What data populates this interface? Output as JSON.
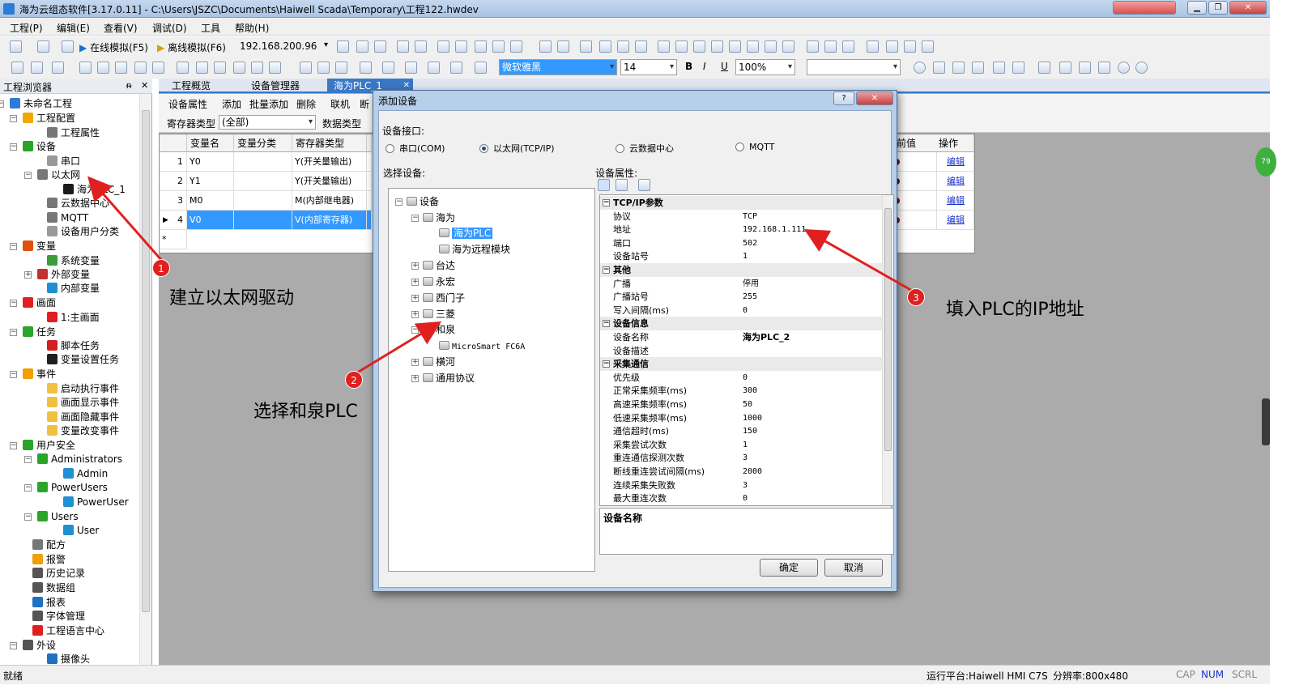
{
  "window": {
    "title": "海为云组态软件[3.17.0.11] - C:\\Users\\JSZC\\Documents\\Haiwell Scada\\Temporary\\工程122.hwdev"
  },
  "menu": [
    "工程(P)",
    "编辑(E)",
    "查看(V)",
    "调试(D)",
    "工具",
    "帮助(H)"
  ],
  "toolbar1": {
    "online_sim": "在线模拟(F5)",
    "offline_sim": "离线模拟(F6)",
    "ip": "192.168.200.96"
  },
  "toolbar2": {
    "font_name": "微软雅黑",
    "font_size": "14",
    "zoom": "100%",
    "bold": "B",
    "italic": "I",
    "underline": "U"
  },
  "explorer": {
    "title": "工程浏览器",
    "pin": "ᵰ",
    "close": "✕"
  },
  "tree": [
    {
      "label": "未命名工程",
      "icon": "project-icon",
      "color": "#2c7bd4"
    },
    {
      "label": "工程配置",
      "icon": "gear-icon",
      "color": "#f0a800"
    },
    {
      "label": "工程属性",
      "icon": "properties-icon",
      "color": "#777777"
    },
    {
      "label": "设备",
      "icon": "device-icon",
      "color": "#2aa52a"
    },
    {
      "label": "串口",
      "icon": "serial-port-icon",
      "color": "#999999"
    },
    {
      "label": "以太网",
      "icon": "ethernet-icon",
      "color": "#777777"
    },
    {
      "label": "海为PLC_1",
      "icon": "plc-icon",
      "color": "#1a1a1a"
    },
    {
      "label": "云数据中心",
      "icon": "cloud-icon",
      "color": "#777777"
    },
    {
      "label": "MQTT",
      "icon": "mqtt-icon",
      "color": "#777777"
    },
    {
      "label": "设备用户分类",
      "icon": "user-class-icon",
      "color": "#999999"
    },
    {
      "label": "变量",
      "icon": "variable-icon",
      "color": "#e05010"
    },
    {
      "label": "系统变量",
      "icon": "system-variable-icon",
      "color": "#3c9c3c"
    },
    {
      "label": "外部变量",
      "icon": "external-variable-icon",
      "color": "#c03030"
    },
    {
      "label": "内部变量",
      "icon": "internal-variable-icon",
      "color": "#1f8fd0"
    },
    {
      "label": "画面",
      "icon": "screen-icon",
      "color": "#e02020"
    },
    {
      "label": "1:主画面",
      "icon": "main-screen-icon",
      "color": "#e02020"
    },
    {
      "label": "任务",
      "icon": "task-icon",
      "color": "#2aa52a"
    },
    {
      "label": "脚本任务",
      "icon": "script-task-icon",
      "color": "#d02020"
    },
    {
      "label": "变量设置任务",
      "icon": "variable-task-icon",
      "color": "#202020"
    },
    {
      "label": "事件",
      "icon": "event-icon",
      "color": "#f0a000"
    },
    {
      "label": "启动执行事件",
      "icon": "event-start-icon",
      "color": "#f0c040"
    },
    {
      "label": "画面显示事件",
      "icon": "event-show-icon",
      "color": "#f0c040"
    },
    {
      "label": "画面隐藏事件",
      "icon": "event-hide-icon",
      "color": "#f0c040"
    },
    {
      "label": "变量改变事件",
      "icon": "event-change-icon",
      "color": "#f0c040"
    },
    {
      "label": "用户安全",
      "icon": "user-security-icon",
      "color": "#2aa52a"
    },
    {
      "label": "Administrators",
      "icon": "group-icon",
      "color": "#2aa52a"
    },
    {
      "label": "Admin",
      "icon": "user-icon",
      "color": "#2090d0"
    },
    {
      "label": "PowerUsers",
      "icon": "group-icon",
      "color": "#2aa52a"
    },
    {
      "label": "PowerUser",
      "icon": "user-icon",
      "color": "#2090d0"
    },
    {
      "label": "Users",
      "icon": "group-icon",
      "color": "#2aa52a"
    },
    {
      "label": "User",
      "icon": "user-icon",
      "color": "#2090d0"
    },
    {
      "label": "配方",
      "icon": "recipe-icon",
      "color": "#777777"
    },
    {
      "label": "报警",
      "icon": "alarm-icon",
      "color": "#f0a000"
    },
    {
      "label": "历史记录",
      "icon": "history-icon",
      "color": "#555555"
    },
    {
      "label": "数据组",
      "icon": "datagroup-icon",
      "color": "#555555"
    },
    {
      "label": "报表",
      "icon": "report-icon",
      "color": "#2070c0"
    },
    {
      "label": "字体管理",
      "icon": "font-icon",
      "color": "#555555"
    },
    {
      "label": "工程语言中心",
      "icon": "language-icon",
      "color": "#e02020"
    },
    {
      "label": "外设",
      "icon": "peripheral-icon",
      "color": "#555555"
    },
    {
      "label": "摄像头",
      "icon": "camera-icon",
      "color": "#2070c0"
    }
  ],
  "tabs": [
    "工程概览",
    "设备管理器",
    "海为PLC_1"
  ],
  "grid_toolbar": {
    "row1": [
      "设备属性",
      "添加",
      "批量添加",
      "删除",
      "联机",
      "断"
    ],
    "reg_type_label": "寄存器类型",
    "reg_type_value": "(全部)",
    "data_type_label": "数据类型"
  },
  "grid": {
    "headers": [
      "变量名",
      "变量分类",
      "寄存器类型",
      "前值",
      "操作"
    ],
    "rows": [
      {
        "num": "1",
        "name": "Y0",
        "cls": "",
        "reg": "Y(开关量输出)",
        "op": "编辑"
      },
      {
        "num": "2",
        "name": "Y1",
        "cls": "",
        "reg": "Y(开关量输出)",
        "op": "编辑"
      },
      {
        "num": "3",
        "name": "M0",
        "cls": "",
        "reg": "M(内部继电器)",
        "op": "编辑"
      },
      {
        "num": "4",
        "name": "V0",
        "cls": "",
        "reg": "V(内部寄存器)",
        "op": "编辑"
      }
    ],
    "new_row": "*",
    "selected_marker": "▶"
  },
  "dialog": {
    "title": "添加设备",
    "help": "?",
    "close": "✕",
    "interface_label": "设备接口:",
    "interfaces": [
      "串口(COM)",
      "以太网(TCP/IP)",
      "云数据中心",
      "MQTT"
    ],
    "select_label": "选择设备:",
    "props_label": "设备属性:",
    "devtree": [
      "设备",
      "海为",
      "海为PLC",
      "海为远程模块",
      "台达",
      "永宏",
      "西门子",
      "三菱",
      "和泉",
      "MicroSmart FC6A",
      "横河",
      "通用协议"
    ],
    "props": [
      {
        "cat": "TCP/IP参数"
      },
      {
        "k": "协议",
        "v": "TCP"
      },
      {
        "k": "地址",
        "v": "192.168.1.111"
      },
      {
        "k": "端口",
        "v": "502"
      },
      {
        "k": "设备站号",
        "v": "1"
      },
      {
        "cat": "其他"
      },
      {
        "k": "广播",
        "v": "停用"
      },
      {
        "k": "广播站号",
        "v": "255"
      },
      {
        "k": "写入间隔(ms)",
        "v": "0"
      },
      {
        "cat": "设备信息"
      },
      {
        "k": "设备名称",
        "v": "海为PLC_2"
      },
      {
        "k": "设备描述",
        "v": ""
      },
      {
        "cat": "采集通信"
      },
      {
        "k": "优先级",
        "v": "0"
      },
      {
        "k": "正常采集频率(ms)",
        "v": "300"
      },
      {
        "k": "高速采集频率(ms)",
        "v": "50"
      },
      {
        "k": "低速采集频率(ms)",
        "v": "1000"
      },
      {
        "k": "通信超时(ms)",
        "v": "150"
      },
      {
        "k": "采集尝试次数",
        "v": "1"
      },
      {
        "k": "重连通信探测次数",
        "v": "3"
      },
      {
        "k": "断线重连尝试间隔(ms)",
        "v": "2000"
      },
      {
        "k": "连续采集失败数",
        "v": "3"
      },
      {
        "k": "最大重连次数",
        "v": "0"
      }
    ],
    "desc_title": "设备名称",
    "ok": "确定",
    "cancel": "取消"
  },
  "annotations": [
    {
      "num": "1",
      "text": "建立以太网驱动"
    },
    {
      "num": "2",
      "text": "选择和泉PLC"
    },
    {
      "num": "3",
      "text": "填入PLC的IP地址"
    }
  ],
  "statusbar": {
    "left": "就绪",
    "platform": "运行平台:Haiwell HMI C7S",
    "resolution": "分辨率:800x480",
    "cap": "CAP",
    "num": "NUM",
    "scrl": "SCRL"
  },
  "colors": {
    "accent": "#3a78c5",
    "selection": "#3399ff",
    "annotation": "#e02020"
  }
}
